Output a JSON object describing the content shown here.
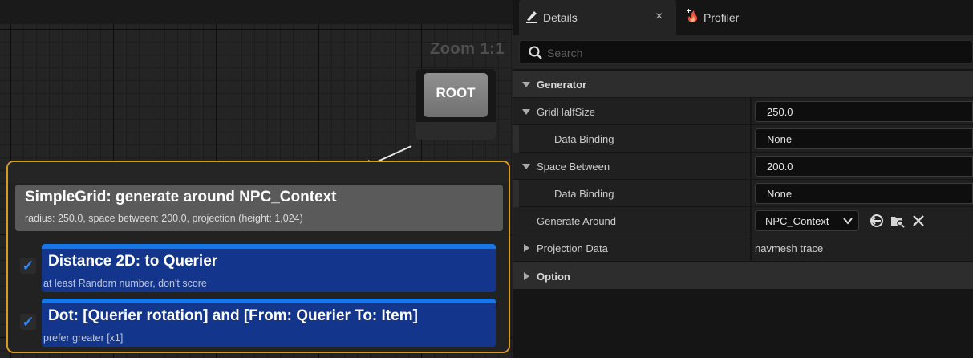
{
  "graph": {
    "zoom_label": "Zoom 1:1",
    "root_node": {
      "label": "ROOT"
    },
    "generator_node": {
      "title": "SimpleGrid: generate around NPC_Context",
      "subtitle": "radius: 250.0, space between: 200.0, projection (height: 1,024)",
      "tests": [
        {
          "title": "Distance 2D: to Querier",
          "subtitle": "at least Random number, don't score",
          "checked": true
        },
        {
          "title": "Dot: [Querier rotation] and [From: Querier To: Item]",
          "subtitle": "prefer greater [x1]",
          "checked": true
        }
      ]
    },
    "colors": {
      "selection_outline": "#d99a1e",
      "test_node": "#14358c",
      "test_bar": "#1677e8"
    }
  },
  "details_panel": {
    "tabs": [
      {
        "label": "Details",
        "icon": "pencil-icon",
        "close": "×"
      },
      {
        "label": "Profiler",
        "icon": "flame-icon"
      }
    ],
    "search": {
      "placeholder": "Search"
    },
    "rows": {
      "generator": "Generator",
      "grid_half_size": {
        "label": "GridHalfSize",
        "value": "250.0"
      },
      "grid_binding": {
        "label": "Data Binding",
        "value": "None"
      },
      "space_between": {
        "label": "Space Between",
        "value": "200.0"
      },
      "space_binding": {
        "label": "Data Binding",
        "value": "None"
      },
      "generate_around": {
        "label": "Generate Around",
        "value": "NPC_Context"
      },
      "projection_data": {
        "label": "Projection Data",
        "value": "navmesh trace"
      },
      "option": "Option"
    }
  }
}
